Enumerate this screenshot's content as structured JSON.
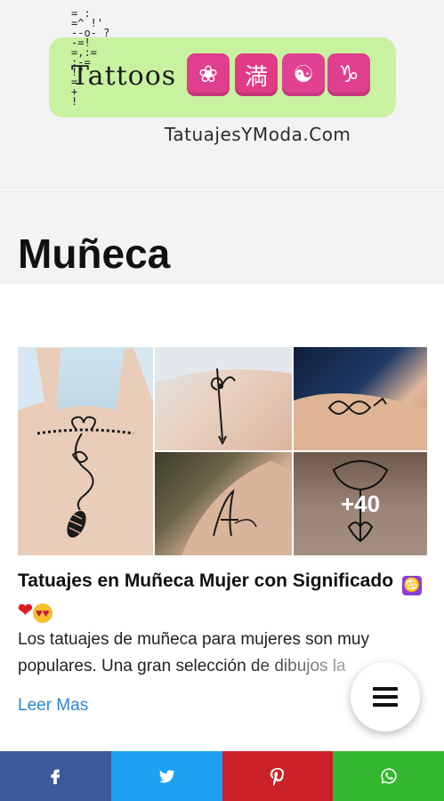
{
  "header": {
    "logo_text": "Tattoos",
    "logo_glyphs": "= :\n=^ !'\n--o- ?\n-=!\n=,:=\n:-=\n!\"\n=\n+\n!",
    "emojis": [
      {
        "icon": "lotus-icon",
        "glyph": "❀",
        "color": "#e03f8d"
      },
      {
        "icon": "kanji-full-icon",
        "glyph": "満",
        "color": "#e23b86"
      },
      {
        "icon": "yin-yang-icon",
        "glyph": "☯",
        "color": "#e04192"
      },
      {
        "icon": "capricorn-icon",
        "glyph": "♑",
        "color": "#df3f8c"
      }
    ],
    "site_url": "TatuajesYModa.Com"
  },
  "page": {
    "title": "Muñeca"
  },
  "post": {
    "gallery_more": "+40",
    "title": "Tatuajes en Muñeca Mujer con Significado",
    "title_emojis": {
      "zodiac": "♋",
      "heart": "❤",
      "smiley": "😍"
    },
    "excerpt": "Los tatuajes de muñeca para mujeres son muy populares. Una gran selección de dibujos la",
    "read_more": "Leer Mas"
  },
  "share": [
    {
      "network": "facebook",
      "icon": "facebook-icon",
      "color": "#3b5a9a"
    },
    {
      "network": "twitter",
      "icon": "twitter-icon",
      "color": "#1ea1f2"
    },
    {
      "network": "pinterest",
      "icon": "pinterest-icon",
      "color": "#cb2128"
    },
    {
      "network": "whatsapp",
      "icon": "whatsapp-icon",
      "color": "#35b830"
    }
  ],
  "colors": {
    "link": "#2a86d6",
    "header_bg": "#f3f3f3",
    "logo_bg": "#c8f2a0"
  }
}
